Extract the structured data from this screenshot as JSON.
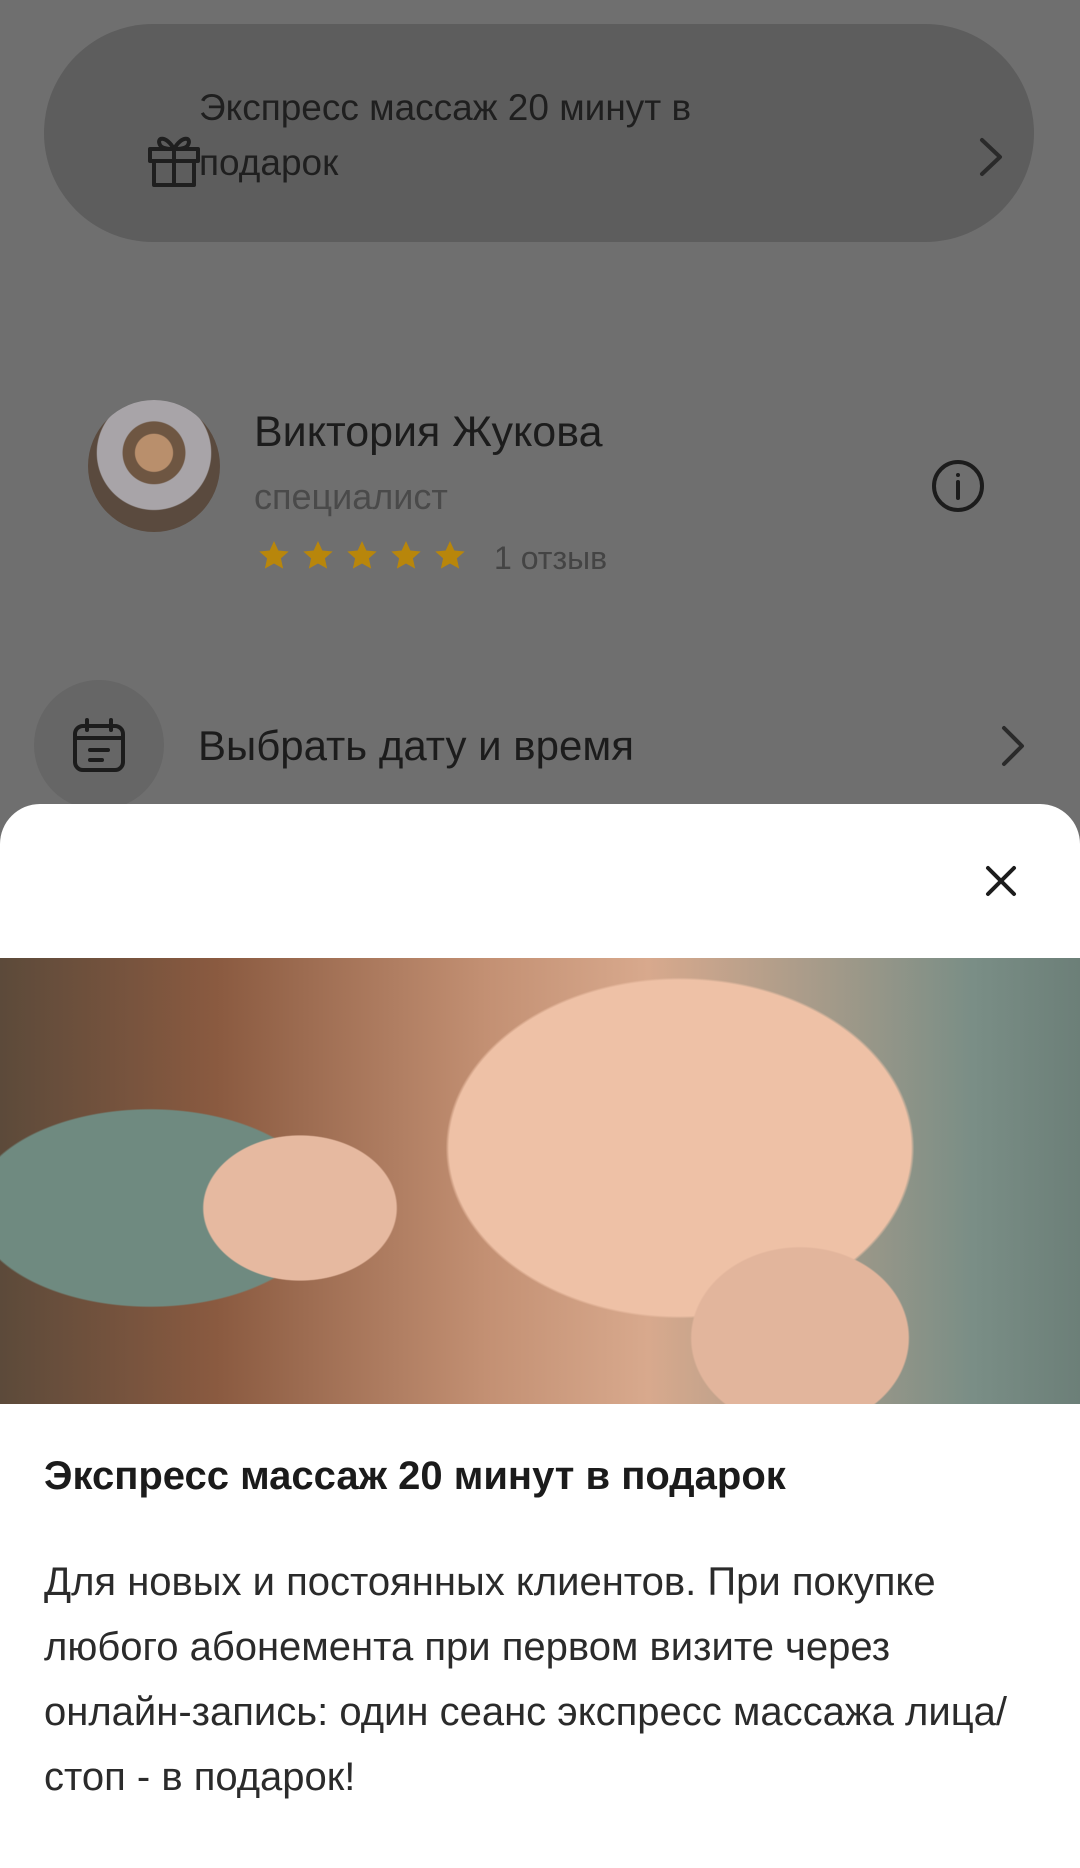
{
  "promo": {
    "text": "Экспресс массаж 20 минут в подарок",
    "icon": "gift-icon"
  },
  "specialist": {
    "name": "Виктория Жукова",
    "role": "специалист",
    "rating": 5,
    "rating_max": 5,
    "reviews": "1 отзыв",
    "star_color": "#b8860b"
  },
  "booking": {
    "pick_date_label": "Выбрать дату и время"
  },
  "sheet": {
    "title": "Экспресс массаж 20 минут в подарок",
    "description": "Для новых и постоянных клиентов. При покупке любого абонемента при первом визите через онлайн-запись: один сеанс экспресс массажа лица/стоп - в подарок!"
  }
}
